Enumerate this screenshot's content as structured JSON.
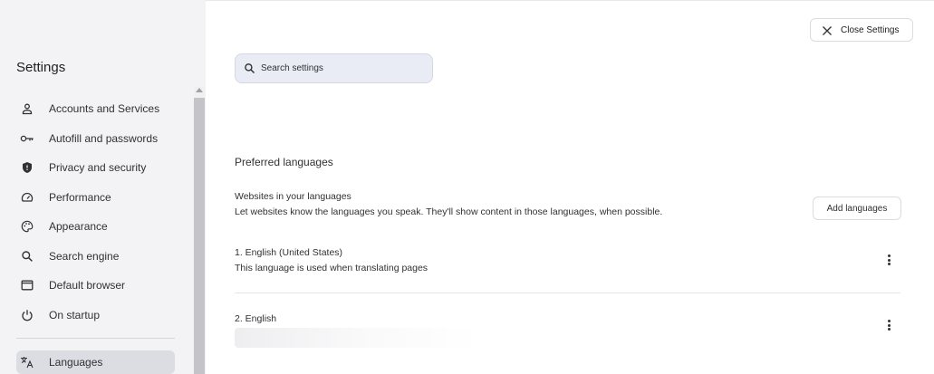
{
  "sidebar": {
    "title": "Settings",
    "items": [
      {
        "label": "Accounts and Services",
        "icon": "person-icon"
      },
      {
        "label": "Autofill and passwords",
        "icon": "key-icon"
      },
      {
        "label": "Privacy and security",
        "icon": "shield-icon"
      },
      {
        "label": "Performance",
        "icon": "speedometer-icon"
      },
      {
        "label": "Appearance",
        "icon": "palette-icon"
      },
      {
        "label": "Search engine",
        "icon": "search-icon"
      },
      {
        "label": "Default browser",
        "icon": "browser-window-icon"
      },
      {
        "label": "On startup",
        "icon": "power-icon"
      }
    ],
    "active_item": {
      "label": "Languages",
      "icon": "translate-icon"
    }
  },
  "search": {
    "placeholder": "Search settings"
  },
  "header": {
    "close_label": "Close Settings"
  },
  "languages": {
    "section_title": "Preferred languages",
    "websites_title": "Websites in your languages",
    "websites_desc": "Let websites know the languages you speak. They'll show content in those languages, when possible.",
    "add_button": "Add languages",
    "list": [
      {
        "name": "1. English (United States)",
        "desc": "This language is used when translating pages"
      },
      {
        "name": "2. English",
        "desc": ""
      }
    ]
  },
  "colors": {
    "sidebar_bg": "#f3f3f5",
    "active_bg": "#dcdde3",
    "search_bg": "#eaecf5"
  }
}
